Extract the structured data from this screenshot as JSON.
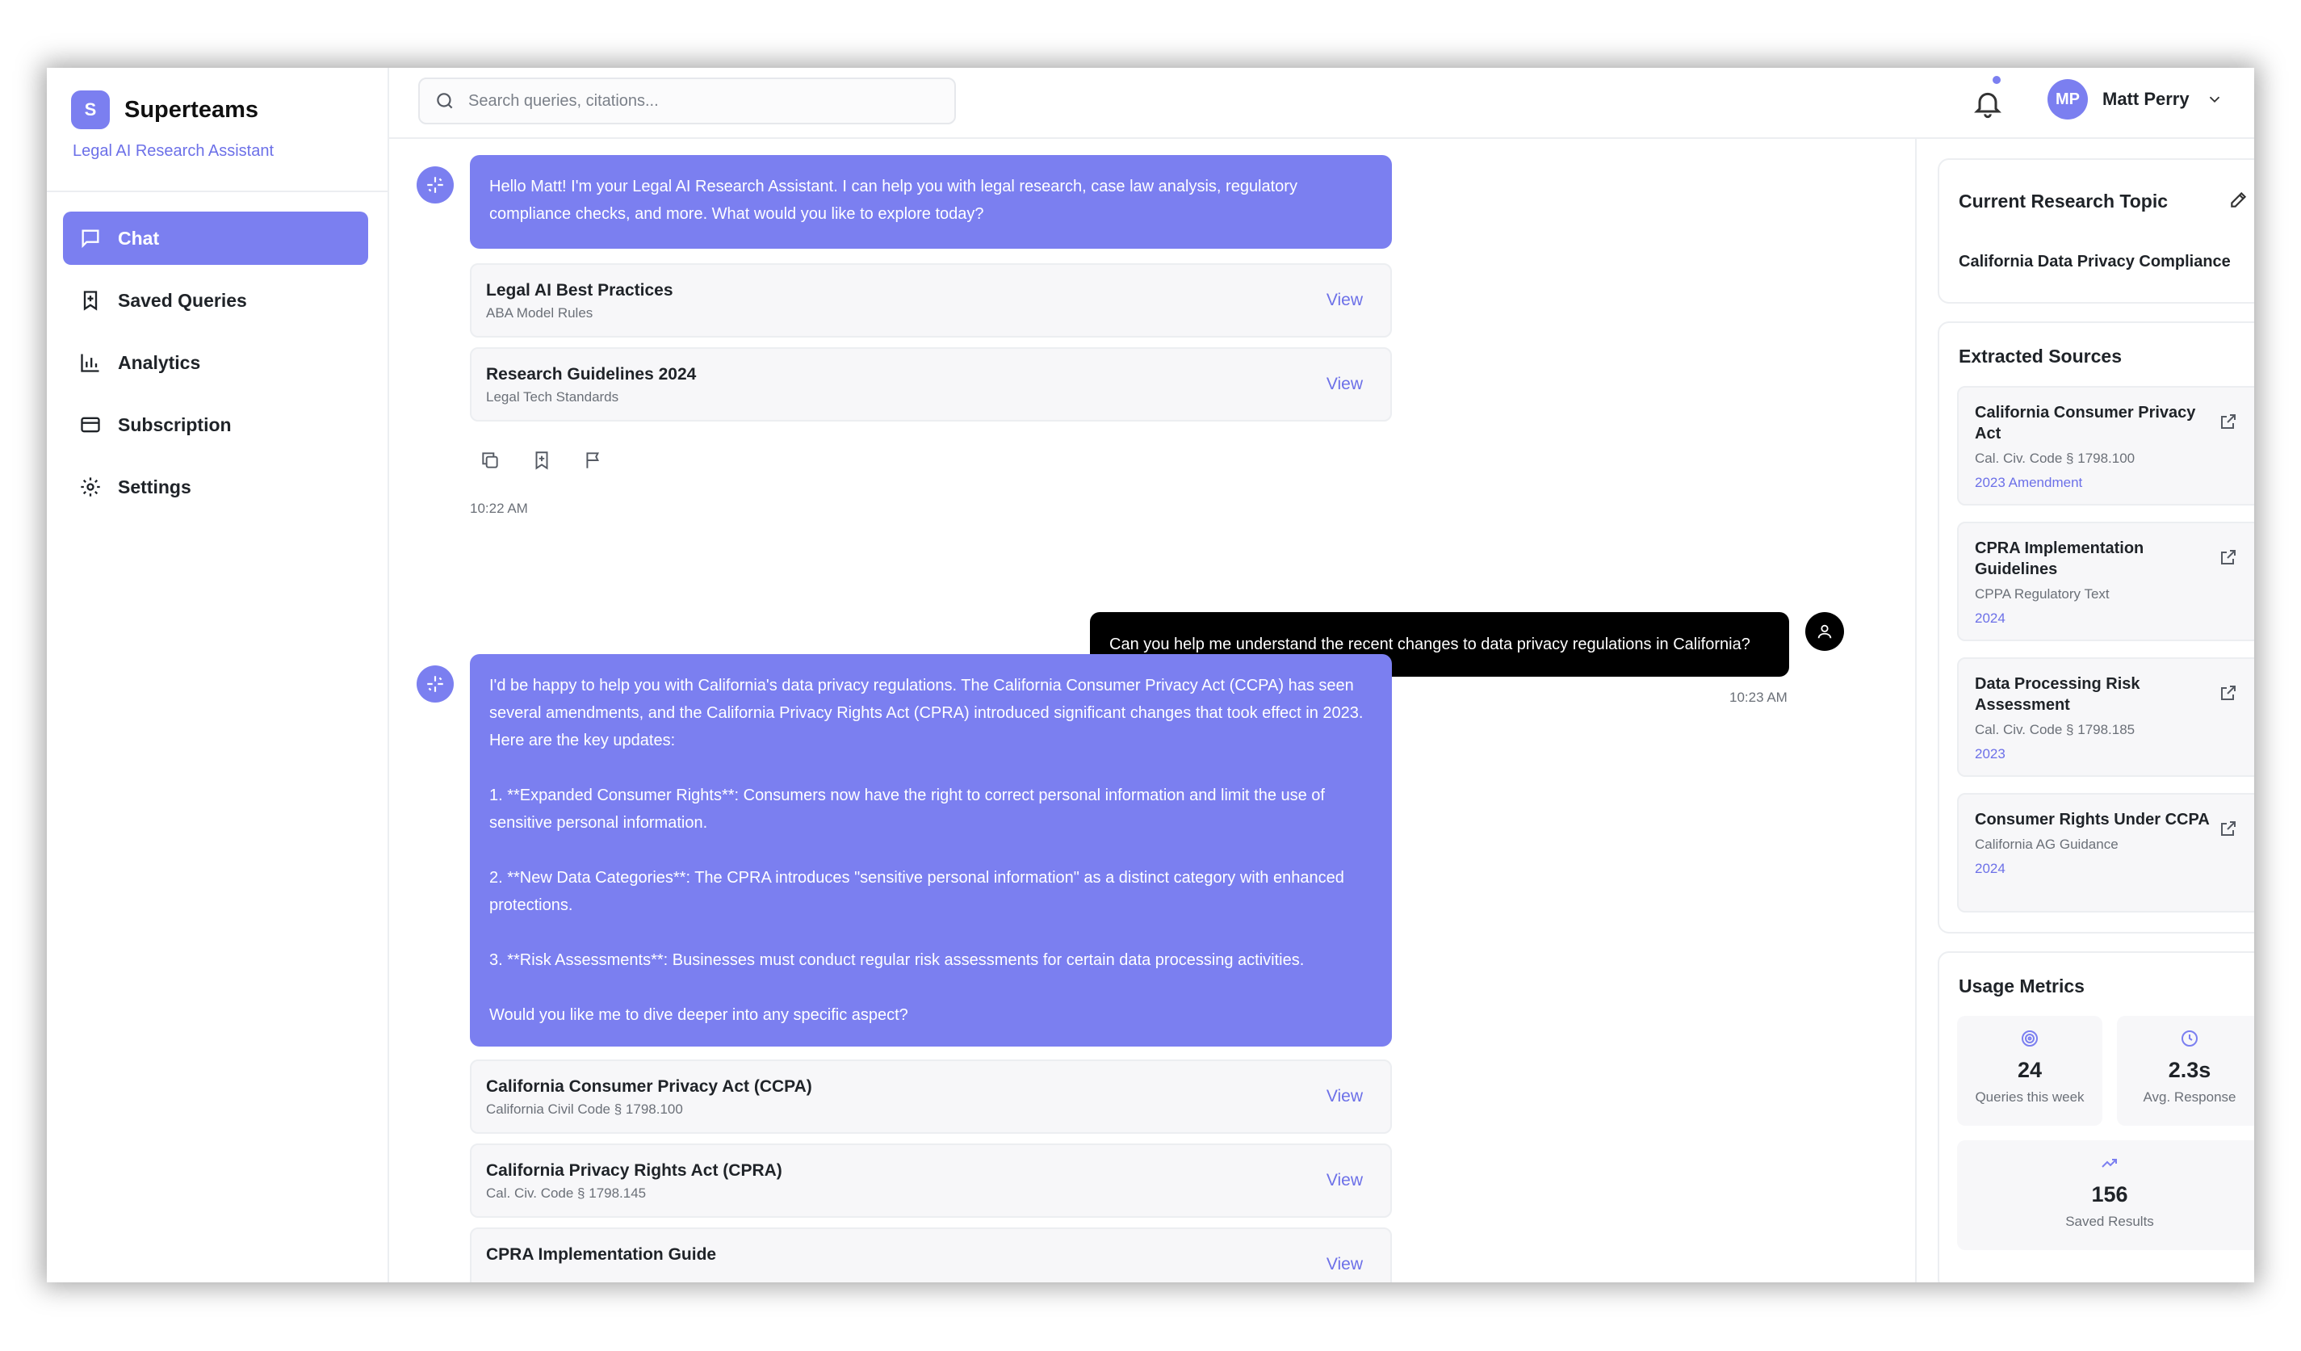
{
  "brand": {
    "logo_letter": "S",
    "name": "Superteams",
    "subtitle": "Legal AI Research Assistant"
  },
  "nav": [
    {
      "label": "Chat",
      "icon": "chat-icon",
      "active": true
    },
    {
      "label": "Saved Queries",
      "icon": "bookmark-icon",
      "active": false
    },
    {
      "label": "Analytics",
      "icon": "bar-chart-icon",
      "active": false
    },
    {
      "label": "Subscription",
      "icon": "credit-card-icon",
      "active": false
    },
    {
      "label": "Settings",
      "icon": "gear-icon",
      "active": false
    }
  ],
  "topbar": {
    "search_placeholder": "Search queries, citations...",
    "user": {
      "initials": "MP",
      "name": "Matt Perry"
    }
  },
  "chat": {
    "messages": [
      {
        "role": "assistant",
        "text": "Hello Matt! I'm your Legal AI Research Assistant. I can help you with legal research, case law analysis, regulatory compliance checks, and more. What would you like to explore today?",
        "sources": [
          {
            "title": "Legal AI Best Practices",
            "subtitle": "ABA Model Rules",
            "action": "View"
          },
          {
            "title": "Research Guidelines 2024",
            "subtitle": "Legal Tech Standards",
            "action": "View"
          }
        ],
        "time": "10:22 AM"
      },
      {
        "role": "user",
        "text": "Can you help me understand the recent changes to data privacy regulations in California?",
        "time": "10:23 AM"
      },
      {
        "role": "assistant",
        "paragraphs": [
          "I'd be happy to help you with California's data privacy regulations. The California Consumer Privacy Act (CCPA) has seen several amendments, and the California Privacy Rights Act (CPRA) introduced significant changes that took effect in 2023. Here are the key updates:",
          "1. **Expanded Consumer Rights**: Consumers now have the right to correct personal information and limit the use of sensitive personal information.",
          "2. **New Data Categories**: The CPRA introduces \"sensitive personal information\" as a distinct category with enhanced protections.",
          "3. **Risk Assessments**: Businesses must conduct regular risk assessments for certain data processing activities.",
          "Would you like me to dive deeper into any specific aspect?"
        ],
        "sources": [
          {
            "title": "California Consumer Privacy Act (CCPA)",
            "subtitle": "California Civil Code § 1798.100",
            "action": "View"
          },
          {
            "title": "California Privacy Rights Act (CPRA)",
            "subtitle": "Cal. Civ. Code § 1798.145",
            "action": "View"
          },
          {
            "title": "CPRA Implementation Guide",
            "subtitle": "",
            "action": "View"
          }
        ]
      }
    ]
  },
  "research_topic": {
    "heading": "Current Research Topic",
    "value": "California Data Privacy Compliance"
  },
  "extracted_sources": {
    "heading": "Extracted Sources",
    "items": [
      {
        "title": "California Consumer Privacy Act",
        "citation": "Cal. Civ. Code § 1798.100",
        "year": "2023 Amendment"
      },
      {
        "title": "CPRA Implementation Guidelines",
        "citation": "CPPA Regulatory Text",
        "year": "2024"
      },
      {
        "title": "Data Processing Risk Assessment",
        "citation": "Cal. Civ. Code § 1798.185",
        "year": "2023"
      },
      {
        "title": "Consumer Rights Under CCPA",
        "citation": "California AG Guidance",
        "year": "2024"
      }
    ]
  },
  "usage_metrics": {
    "heading": "Usage Metrics",
    "items": [
      {
        "value": "24",
        "label": "Queries this week",
        "icon": "target-icon"
      },
      {
        "value": "2.3s",
        "label": "Avg. Response",
        "icon": "clock-icon"
      },
      {
        "value": "156",
        "label": "Saved Results",
        "icon": "trending-up-icon"
      }
    ]
  },
  "colors": {
    "accent": "#7b7ff0",
    "accent_text": "#6c70e8",
    "user_bubble": "#000000"
  }
}
